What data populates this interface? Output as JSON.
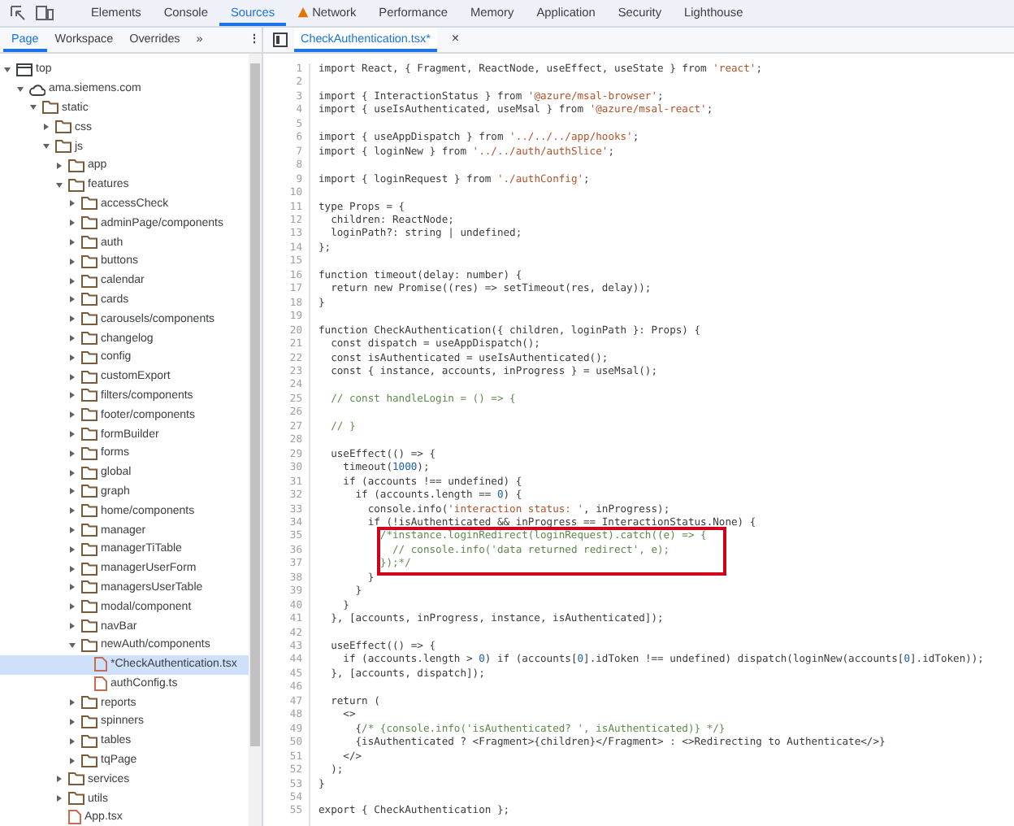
{
  "panel_tabs": [
    {
      "label": "Elements",
      "selected": false,
      "warning": false
    },
    {
      "label": "Console",
      "selected": false,
      "warning": false
    },
    {
      "label": "Sources",
      "selected": true,
      "warning": false
    },
    {
      "label": "Network",
      "selected": false,
      "warning": true
    },
    {
      "label": "Performance",
      "selected": false,
      "warning": false
    },
    {
      "label": "Memory",
      "selected": false,
      "warning": false
    },
    {
      "label": "Application",
      "selected": false,
      "warning": false
    },
    {
      "label": "Security",
      "selected": false,
      "warning": false
    },
    {
      "label": "Lighthouse",
      "selected": false,
      "warning": false
    }
  ],
  "navigator_tabs": [
    {
      "label": "Page",
      "selected": true
    },
    {
      "label": "Workspace",
      "selected": false
    },
    {
      "label": "Overrides",
      "selected": false
    }
  ],
  "more_tabs": "»",
  "menu": "⋮",
  "file_tab": {
    "label": "CheckAuthentication.tsx*",
    "close": "×"
  },
  "tree": [
    {
      "label": "top",
      "kind": "frame",
      "expanded": true,
      "selected": false,
      "children": [
        {
          "label": "ama.siemens.com",
          "kind": "domain",
          "expanded": true,
          "selected": false,
          "children": [
            {
              "label": "static",
              "kind": "folder",
              "expanded": true,
              "selected": false,
              "children": [
                {
                  "label": "css",
                  "kind": "folder",
                  "expanded": false,
                  "selected": false
                },
                {
                  "label": "js",
                  "kind": "folder",
                  "expanded": true,
                  "selected": false,
                  "children": [
                    {
                      "label": "app",
                      "kind": "folder",
                      "expanded": false,
                      "selected": false
                    },
                    {
                      "label": "features",
                      "kind": "folder",
                      "expanded": true,
                      "selected": false,
                      "children": [
                        {
                          "label": "accessCheck",
                          "kind": "folder",
                          "expanded": false,
                          "selected": false
                        },
                        {
                          "label": "adminPage/components",
                          "kind": "folder",
                          "expanded": false,
                          "selected": false
                        },
                        {
                          "label": "auth",
                          "kind": "folder",
                          "expanded": false,
                          "selected": false
                        },
                        {
                          "label": "buttons",
                          "kind": "folder",
                          "expanded": false,
                          "selected": false
                        },
                        {
                          "label": "calendar",
                          "kind": "folder",
                          "expanded": false,
                          "selected": false
                        },
                        {
                          "label": "cards",
                          "kind": "folder",
                          "expanded": false,
                          "selected": false
                        },
                        {
                          "label": "carousels/components",
                          "kind": "folder",
                          "expanded": false,
                          "selected": false
                        },
                        {
                          "label": "changelog",
                          "kind": "folder",
                          "expanded": false,
                          "selected": false
                        },
                        {
                          "label": "config",
                          "kind": "folder",
                          "expanded": false,
                          "selected": false
                        },
                        {
                          "label": "customExport",
                          "kind": "folder",
                          "expanded": false,
                          "selected": false
                        },
                        {
                          "label": "filters/components",
                          "kind": "folder",
                          "expanded": false,
                          "selected": false
                        },
                        {
                          "label": "footer/components",
                          "kind": "folder",
                          "expanded": false,
                          "selected": false
                        },
                        {
                          "label": "formBuilder",
                          "kind": "folder",
                          "expanded": false,
                          "selected": false
                        },
                        {
                          "label": "forms",
                          "kind": "folder",
                          "expanded": false,
                          "selected": false
                        },
                        {
                          "label": "global",
                          "kind": "folder",
                          "expanded": false,
                          "selected": false
                        },
                        {
                          "label": "graph",
                          "kind": "folder",
                          "expanded": false,
                          "selected": false
                        },
                        {
                          "label": "home/components",
                          "kind": "folder",
                          "expanded": false,
                          "selected": false
                        },
                        {
                          "label": "manager",
                          "kind": "folder",
                          "expanded": false,
                          "selected": false
                        },
                        {
                          "label": "managerTiTable",
                          "kind": "folder",
                          "expanded": false,
                          "selected": false
                        },
                        {
                          "label": "managerUserForm",
                          "kind": "folder",
                          "expanded": false,
                          "selected": false
                        },
                        {
                          "label": "managersUserTable",
                          "kind": "folder",
                          "expanded": false,
                          "selected": false
                        },
                        {
                          "label": "modal/component",
                          "kind": "folder",
                          "expanded": false,
                          "selected": false
                        },
                        {
                          "label": "navBar",
                          "kind": "folder",
                          "expanded": false,
                          "selected": false
                        },
                        {
                          "label": "newAuth/components",
                          "kind": "folder",
                          "expanded": true,
                          "selected": false,
                          "children": [
                            {
                              "label": "*CheckAuthentication.tsx",
                              "kind": "file",
                              "selected": true
                            },
                            {
                              "label": "authConfig.ts",
                              "kind": "file",
                              "selected": false
                            }
                          ]
                        },
                        {
                          "label": "reports",
                          "kind": "folder",
                          "expanded": false,
                          "selected": false
                        },
                        {
                          "label": "spinners",
                          "kind": "folder",
                          "expanded": false,
                          "selected": false
                        },
                        {
                          "label": "tables",
                          "kind": "folder",
                          "expanded": false,
                          "selected": false
                        },
                        {
                          "label": "tqPage",
                          "kind": "folder",
                          "expanded": false,
                          "selected": false
                        }
                      ]
                    },
                    {
                      "label": "services",
                      "kind": "folder",
                      "expanded": false,
                      "selected": false
                    },
                    {
                      "label": "utils",
                      "kind": "folder",
                      "expanded": false,
                      "selected": false
                    },
                    {
                      "label": "App.tsx",
                      "kind": "file",
                      "selected": false
                    }
                  ]
                }
              ]
            }
          ]
        }
      ]
    }
  ],
  "code_lines": [
    {
      "number": "1",
      "text": "import React, { Fragment, ReactNode, useEffect, useState } from 'react';",
      "highlighted": false
    },
    {
      "number": "2",
      "highlighted": false
    },
    {
      "number": "3",
      "text": "import { InteractionStatus } from '@azure/msal-browser';",
      "highlighted": false
    },
    {
      "number": "4",
      "text": "import { useIsAuthenticated, useMsal } from '@azure/msal-react';",
      "highlighted": false
    },
    {
      "number": "5",
      "highlighted": false
    },
    {
      "number": "6",
      "text": "import { useAppDispatch } from '../../../app/hooks';",
      "highlighted": false
    },
    {
      "number": "7",
      "text": "import { loginNew } from '../../auth/authSlice';",
      "highlighted": false
    },
    {
      "number": "8",
      "highlighted": false
    },
    {
      "number": "9",
      "text": "import { loginRequest } from './authConfig';",
      "highlighted": false
    },
    {
      "number": "10",
      "highlighted": false
    },
    {
      "number": "11",
      "text": "type Props = {",
      "highlighted": false
    },
    {
      "number": "12",
      "text": "  children: ReactNode;",
      "highlighted": false
    },
    {
      "number": "13",
      "text": "  loginPath?: string | undefined;",
      "highlighted": false
    },
    {
      "number": "14",
      "text": "};",
      "highlighted": false
    },
    {
      "number": "15",
      "highlighted": false
    },
    {
      "number": "16",
      "text": "function timeout(delay: number) {",
      "highlighted": false
    },
    {
      "number": "17",
      "text": "  return new Promise((res) => setTimeout(res, delay));",
      "highlighted": false
    },
    {
      "number": "18",
      "text": "}",
      "highlighted": false
    },
    {
      "number": "19",
      "highlighted": false
    },
    {
      "number": "20",
      "text": "function CheckAuthentication({ children, loginPath }: Props) {",
      "highlighted": false
    },
    {
      "number": "21",
      "text": "  const dispatch = useAppDispatch();",
      "highlighted": false
    },
    {
      "number": "22",
      "text": "  const isAuthenticated = useIsAuthenticated();",
      "highlighted": false
    },
    {
      "number": "23",
      "text": "  const { instance, accounts, inProgress } = useMsal();",
      "highlighted": false
    },
    {
      "number": "24",
      "highlighted": false
    },
    {
      "number": "25",
      "text": "  // const handleLogin = () => {",
      "highlighted": false
    },
    {
      "number": "26",
      "highlighted": false
    },
    {
      "number": "27",
      "text": "  // }",
      "highlighted": false
    },
    {
      "number": "28",
      "highlighted": false
    },
    {
      "number": "29",
      "text": "  useEffect(() => {",
      "highlighted": false
    },
    {
      "number": "30",
      "text": "    timeout(1000);",
      "highlighted": false
    },
    {
      "number": "31",
      "text": "    if (accounts !== undefined) {",
      "highlighted": false
    },
    {
      "number": "32",
      "text": "      if (accounts.length == 0) {",
      "highlighted": false
    },
    {
      "number": "33",
      "text": "        console.info('interaction status: ', inProgress);",
      "highlighted": false
    },
    {
      "number": "34",
      "text": "        if (!isAuthenticated && inProgress == InteractionStatus.None) {",
      "highlighted": false
    },
    {
      "number": "35",
      "text": "          /*instance.loginRedirect(loginRequest).catch((e) => {",
      "highlighted": true
    },
    {
      "number": "36",
      "text": "            // console.info('data returned redirect', e);",
      "highlighted": true
    },
    {
      "number": "37",
      "text": "          });*/",
      "highlighted": true
    },
    {
      "number": "38",
      "text": "        }",
      "highlighted": false
    },
    {
      "number": "39",
      "text": "      }",
      "highlighted": false
    },
    {
      "number": "40",
      "text": "    }",
      "highlighted": false
    },
    {
      "number": "41",
      "text": "  }, [accounts, inProgress, instance, isAuthenticated]);",
      "highlighted": false
    },
    {
      "number": "42",
      "highlighted": false
    },
    {
      "number": "43",
      "text": "  useEffect(() => {",
      "highlighted": false
    },
    {
      "number": "44",
      "text": "    if (accounts.length > 0) if (accounts[0].idToken !== undefined) dispatch(loginNew(accounts[0].idToken));",
      "highlighted": false
    },
    {
      "number": "45",
      "text": "  }, [accounts, dispatch]);",
      "highlighted": false
    },
    {
      "number": "46",
      "highlighted": false
    },
    {
      "number": "47",
      "text": "  return (",
      "highlighted": false
    },
    {
      "number": "48",
      "text": "    <>",
      "highlighted": false
    },
    {
      "number": "49",
      "text": "      {/* {console.info('isAuthenticated? ', isAuthenticated)} */}",
      "highlighted": false
    },
    {
      "number": "50",
      "text": "      {isAuthenticated ? <Fragment>{children}</Fragment> : <>Redirecting to Authenticate</>}",
      "highlighted": false
    },
    {
      "number": "51",
      "text": "    </>",
      "highlighted": false
    },
    {
      "number": "52",
      "text": "  );",
      "highlighted": false
    },
    {
      "number": "53",
      "text": "}",
      "highlighted": false
    },
    {
      "number": "54",
      "highlighted": false
    },
    {
      "number": "55",
      "text": "export { CheckAuthentication };",
      "highlighted": false
    }
  ]
}
